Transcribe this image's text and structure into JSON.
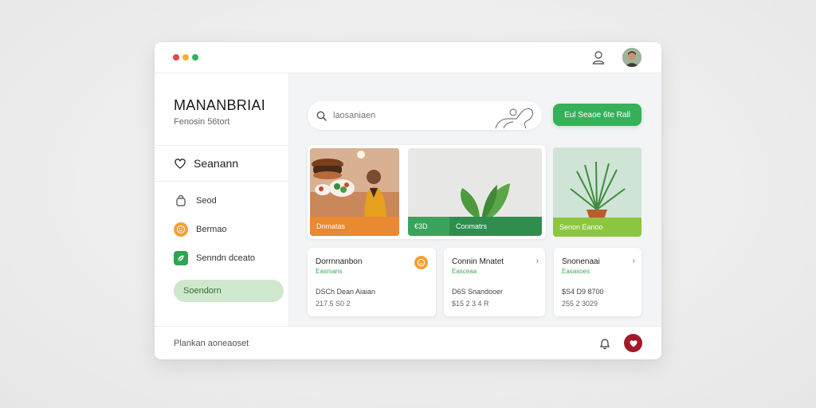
{
  "window": {
    "controls": [
      "close",
      "minimize",
      "maximize"
    ],
    "icons": {
      "user": "user-icon",
      "avatar": "avatar"
    }
  },
  "sidebar": {
    "brand": "MANANBRIAI",
    "brand_sub": "Fenosin 56tort",
    "section": {
      "icon": "heart-chat-icon",
      "label": "Seanann"
    },
    "items": [
      {
        "icon": "bag-icon",
        "label": "Seod"
      },
      {
        "icon": "smile-icon",
        "label": "Bermao"
      },
      {
        "icon": "leaf-icon",
        "label": "Senndn dceato"
      }
    ],
    "active_item": "Soendorn"
  },
  "main": {
    "search": {
      "placeholder": "laosaniaen"
    },
    "cta_label": "Eul Seaoe 6te Rall",
    "media": [
      {
        "label": "Dnmatas",
        "color": "#e98932"
      },
      {
        "label": "€3D",
        "color": "#3aa35b"
      },
      {
        "label": "Conmatrs",
        "color": "#2f8e4e"
      },
      {
        "label": "Senon Eanoo",
        "color": "#8cc63f"
      }
    ],
    "cards": [
      {
        "title": "Dorrnnanbon",
        "subtitle": "Easmans",
        "line1": "DSCh Dean Aiaian",
        "line2": "217.5 S0 2",
        "badge": "smile-icon"
      },
      {
        "title": "Connin Mnatet",
        "subtitle": "Easceaa",
        "line1": "D6S Snandooer",
        "line2": "$15 2 3 4 R",
        "chevron": "›"
      },
      {
        "title": "Snonenaai",
        "subtitle": "Easasoes",
        "line1": "$S4 D9 8700",
        "line2": "255 2 3029",
        "chevron": "›"
      }
    ]
  },
  "footer": {
    "text": "Plankan aoneaoset",
    "icons": [
      "bell-icon",
      "heart-icon"
    ]
  },
  "colors": {
    "accent_green": "#37b05a",
    "accent_orange": "#f2a233",
    "accent_red": "#a3182b",
    "active_bg": "#cfe8cd"
  }
}
